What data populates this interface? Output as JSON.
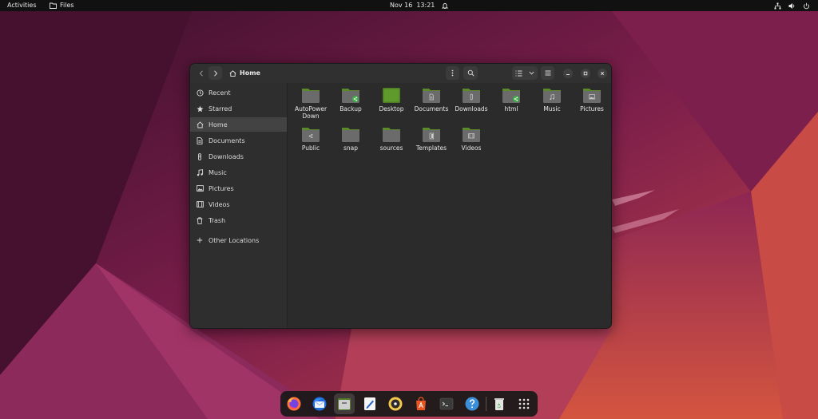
{
  "topbar": {
    "activities": "Activities",
    "app_name": "Files",
    "date": "Nov 16",
    "time": "13:21"
  },
  "window": {
    "path": "Home"
  },
  "sidebar": {
    "items": [
      {
        "label": "Recent",
        "icon": "clock-icon"
      },
      {
        "label": "Starred",
        "icon": "star-icon"
      },
      {
        "label": "Home",
        "icon": "home-icon",
        "active": true
      },
      {
        "label": "Documents",
        "icon": "document-icon"
      },
      {
        "label": "Downloads",
        "icon": "download-icon"
      },
      {
        "label": "Music",
        "icon": "music-icon"
      },
      {
        "label": "Pictures",
        "icon": "picture-icon"
      },
      {
        "label": "Videos",
        "icon": "video-icon"
      },
      {
        "label": "Trash",
        "icon": "trash-icon"
      }
    ],
    "other_locations": "Other Locations"
  },
  "files": [
    {
      "name": "AutoPower Down",
      "emblem": "none"
    },
    {
      "name": "Backup",
      "emblem": "share"
    },
    {
      "name": "Desktop",
      "emblem": "desktop"
    },
    {
      "name": "Documents",
      "emblem": "document"
    },
    {
      "name": "Downloads",
      "emblem": "download"
    },
    {
      "name": "html",
      "emblem": "share"
    },
    {
      "name": "Music",
      "emblem": "music"
    },
    {
      "name": "Pictures",
      "emblem": "picture"
    },
    {
      "name": "Public",
      "emblem": "public"
    },
    {
      "name": "snap",
      "emblem": "none"
    },
    {
      "name": "sources",
      "emblem": "none"
    },
    {
      "name": "Templates",
      "emblem": "template"
    },
    {
      "name": "Videos",
      "emblem": "video"
    }
  ],
  "dock": [
    "firefox-icon",
    "thunderbird-icon",
    "files-icon",
    "text-editor-icon",
    "rhythmbox-icon",
    "app-center-icon",
    "terminal-icon",
    "help-icon",
    "trash-icon",
    "show-apps-icon"
  ],
  "colors": {
    "folder_body": "#6b6b6b",
    "folder_tab": "#5b8a2a",
    "accent_green": "#3fae48"
  }
}
